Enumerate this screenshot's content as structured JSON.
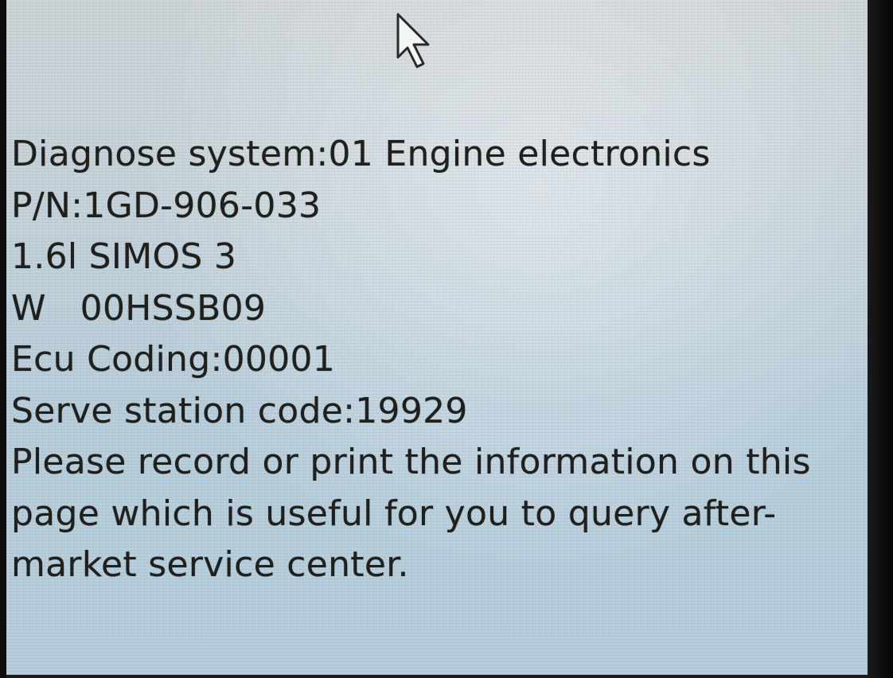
{
  "screen": {
    "lines": [
      "Diagnose system:01 Engine electronics",
      "P/N:1GD-906-033",
      "1.6l SIMOS 3",
      "W   00HSSB09",
      "Ecu Coding:00001",
      "Serve station code:19929",
      "Please record or print the information on this",
      "page which is useful for you to query after-",
      "market service center."
    ]
  },
  "icons": {
    "cursor": "mouse-pointer-arrow-icon"
  }
}
